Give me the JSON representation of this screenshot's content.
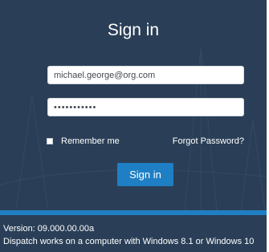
{
  "login": {
    "title": "Sign in",
    "email_value": "michael.george@org.com",
    "password_value": "•••••••••••",
    "remember_label": "Remember me",
    "forgot_label": "Forgot Password?",
    "signin_button": "Sign in"
  },
  "footer": {
    "version": "Version: 09.000.00.00a",
    "requirement": "Dispatch works on a computer with Windows 8.1 or Windows 10"
  },
  "colors": {
    "panel_background": "#2a3f57",
    "button_accent": "#1f7fc4"
  }
}
